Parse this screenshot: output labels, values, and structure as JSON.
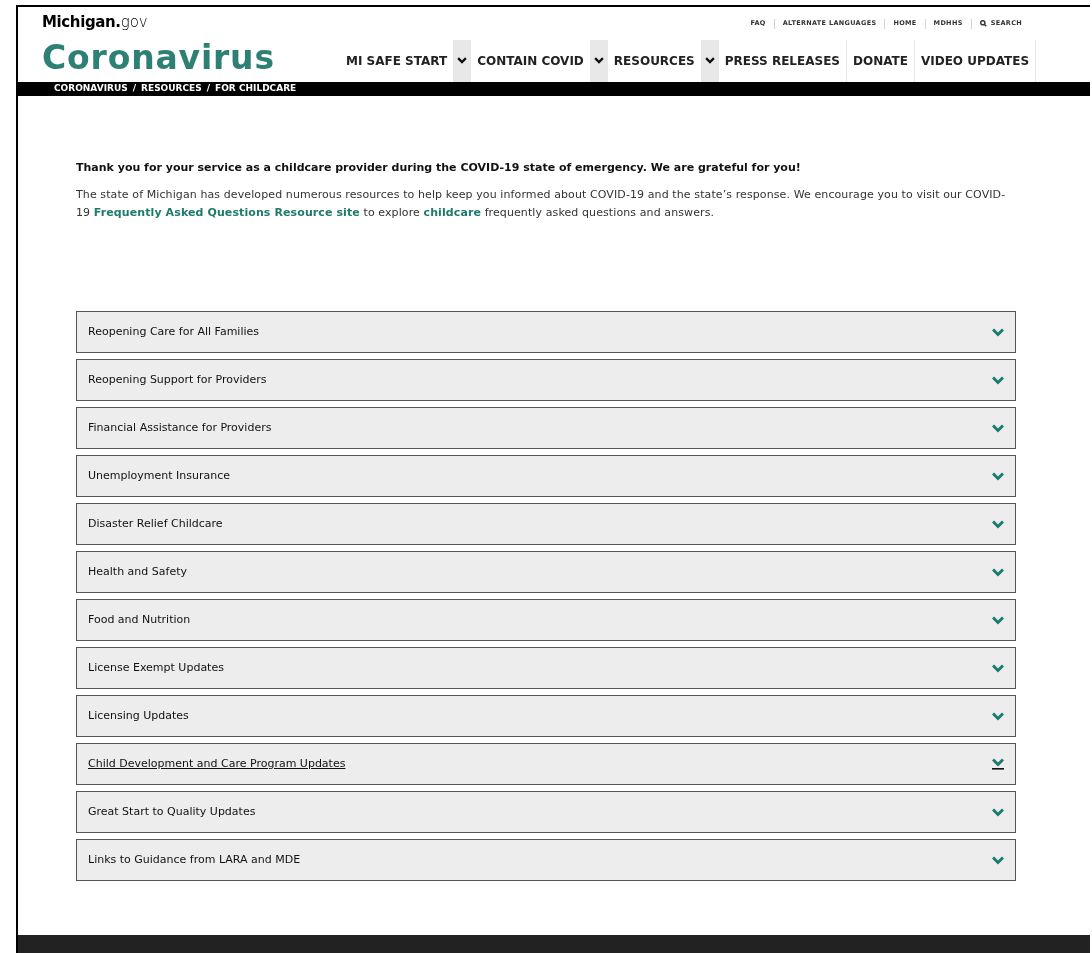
{
  "header": {
    "logo_bold": "Michigan.",
    "logo_light": "gov",
    "title": "Coronavirus",
    "utility_links": [
      {
        "kind": "text",
        "label": "FAQ"
      },
      {
        "kind": "text",
        "label": "ALTERNATE LANGUAGES"
      },
      {
        "kind": "text",
        "label": "HOME"
      },
      {
        "kind": "text",
        "label": "MDHHS"
      },
      {
        "kind": "search",
        "label": "SEARCH"
      }
    ],
    "nav": [
      {
        "label": "MI SAFE START",
        "kind": "dropdown"
      },
      {
        "label": "CONTAIN COVID",
        "kind": "dropdown"
      },
      {
        "label": "RESOURCES",
        "kind": "dropdown"
      },
      {
        "label": "PRESS RELEASES",
        "kind": "link"
      },
      {
        "label": "DONATE",
        "kind": "link"
      },
      {
        "label": "VIDEO UPDATES",
        "kind": "link"
      }
    ]
  },
  "breadcrumb": [
    {
      "kind": "link",
      "text": "CORONAVIRUS"
    },
    {
      "kind": "separator",
      "text": "/"
    },
    {
      "kind": "link",
      "text": "RESOURCES"
    },
    {
      "kind": "separator",
      "text": "/"
    },
    {
      "kind": "link",
      "text": "FOR CHILDCARE"
    }
  ],
  "intro": {
    "heading": "Thank you for your service as a childcare provider during the COVID-19 state of emergency. We are grateful for you!",
    "parts": [
      {
        "kind": "text",
        "text": "The state of Michigan has developed numerous resources to help keep you informed about COVID-19 and the state’s response. We encourage you to visit our COVID-19 "
      },
      {
        "kind": "link",
        "text": "Frequently Asked Questions Resource site"
      },
      {
        "kind": "text",
        "text": " to explore "
      },
      {
        "kind": "link",
        "text": "childcare"
      },
      {
        "kind": "text",
        "text": " frequently asked questions and answers."
      }
    ]
  },
  "accordion": [
    {
      "label": "Reopening Care for All Families",
      "hovered": false
    },
    {
      "label": "Reopening Support for Providers",
      "hovered": false
    },
    {
      "label": "Financial Assistance for Providers",
      "hovered": false
    },
    {
      "label": "Unemployment Insurance",
      "hovered": false
    },
    {
      "label": "Disaster Relief Childcare",
      "hovered": false
    },
    {
      "label": "Health and Safety",
      "hovered": false
    },
    {
      "label": "Food and Nutrition",
      "hovered": false
    },
    {
      "label": "License Exempt Updates",
      "hovered": false
    },
    {
      "label": "Licensing Updates",
      "hovered": false
    },
    {
      "label": "Child Development and Care Program Updates",
      "hovered": true
    },
    {
      "label": "Great Start to Quality Updates",
      "hovered": false
    },
    {
      "label": "Links to Guidance from LARA and MDE",
      "hovered": false
    }
  ]
}
